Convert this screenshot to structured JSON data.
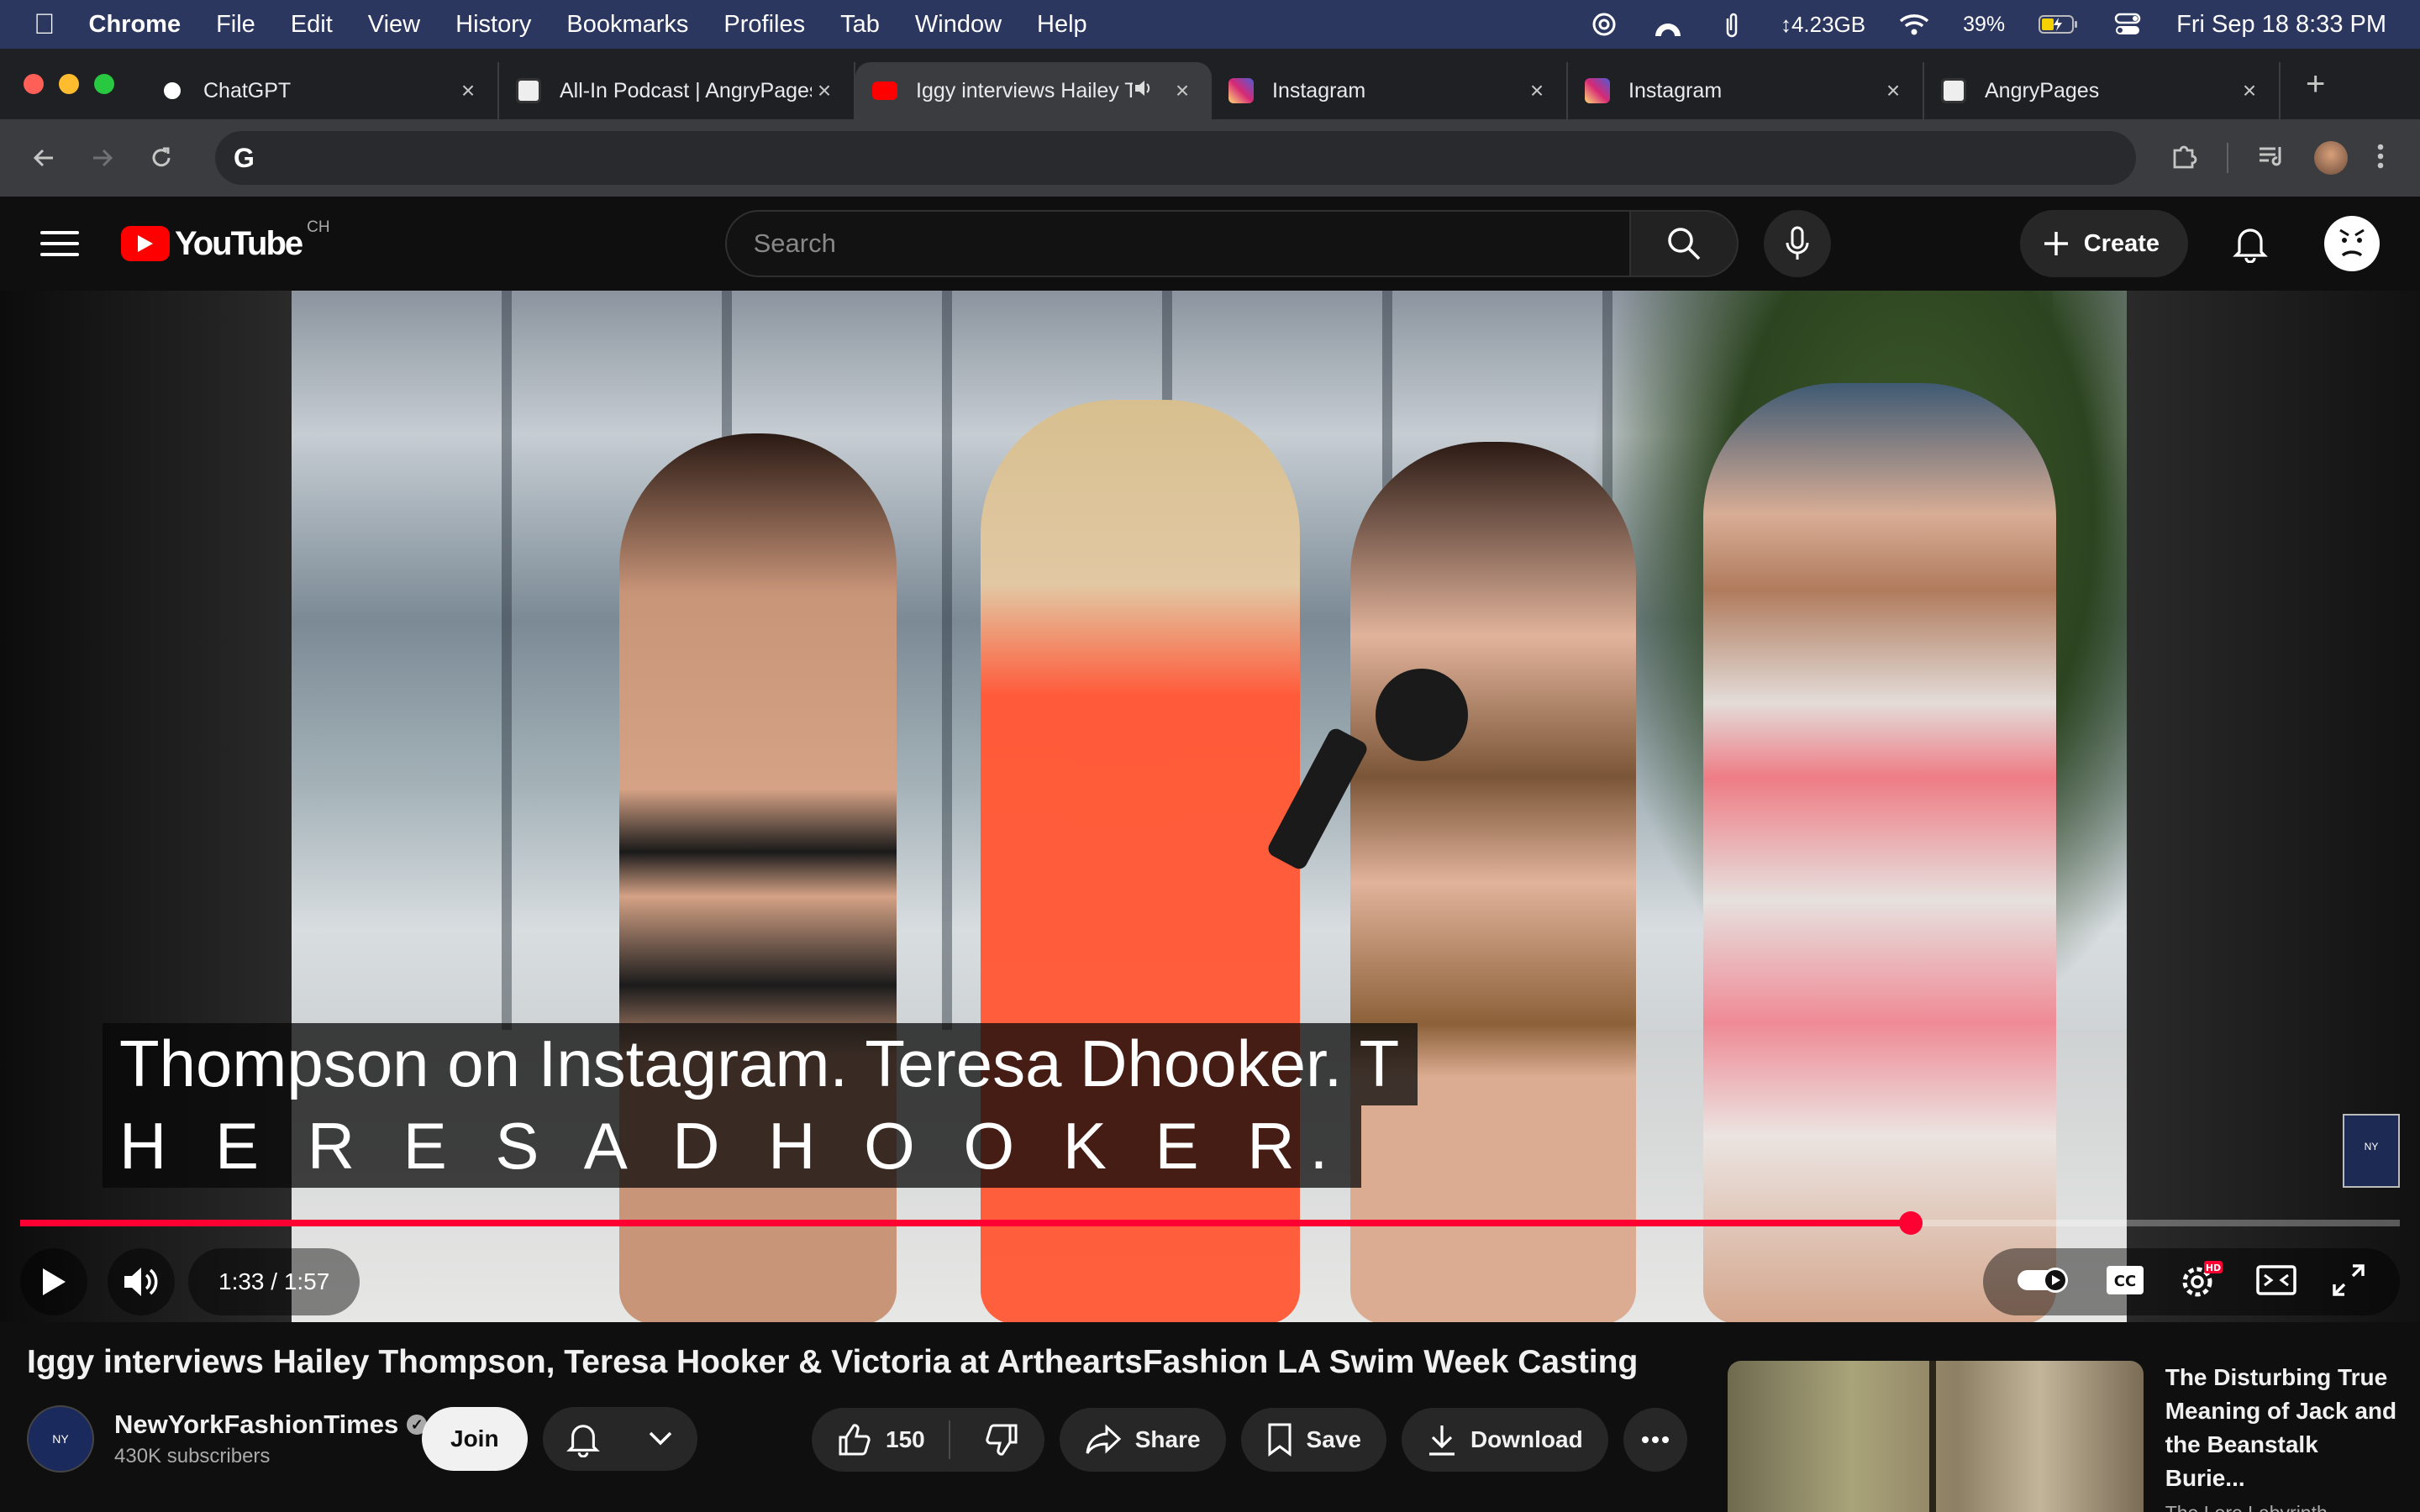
{
  "menubar": {
    "app_name": "Chrome",
    "items": [
      "File",
      "Edit",
      "View",
      "History",
      "Bookmarks",
      "Profiles",
      "Tab",
      "Window",
      "Help"
    ],
    "memory": "↕4.23GB",
    "battery": "39%",
    "datetime": "Fri Sep 18  8:33 PM"
  },
  "tabs": [
    {
      "title": "ChatGPT",
      "icon": "chatgpt-icon",
      "active": false
    },
    {
      "title": "All-In Podcast | AngryPages",
      "icon": "angrypages-icon",
      "active": false
    },
    {
      "title": "Iggy interviews Hailey Thompson",
      "icon": "youtube-icon",
      "active": true
    },
    {
      "title": "Instagram",
      "icon": "instagram-icon",
      "active": false
    },
    {
      "title": "Instagram",
      "icon": "instagram-icon",
      "active": false
    },
    {
      "title": "AngryPages",
      "icon": "angrypages-icon",
      "active": false
    }
  ],
  "toolbar": {
    "omnibox_value": "",
    "omnibox_icon": "G"
  },
  "youtube": {
    "logo_text": "YouTube",
    "country_code": "CH",
    "search_placeholder": "Search",
    "create_label": "Create"
  },
  "player": {
    "captions": [
      "Thompson on Instagram. Teresa Dhooker. T",
      "H E R E S A D H O O K E R."
    ],
    "current_time": "1:33",
    "duration": "1:57",
    "time_display": "1:33 / 1:57",
    "progress": 0.7945,
    "watermark_text": "NY"
  },
  "video": {
    "title": "Iggy interviews Hailey Thompson, Teresa Hooker & Victoria at ArtheartsFashion LA Swim Week Casting",
    "channel_name": "NewYorkFashionTimes",
    "subscribers": "430K subscribers",
    "join_label": "Join",
    "like_count": "150",
    "share_label": "Share",
    "save_label": "Save",
    "download_label": "Download"
  },
  "suggested": {
    "title": "The Disturbing True Meaning of Jack and the Beanstalk Burie...",
    "channel": "The Lore Labyrinth"
  },
  "colors": {
    "youtube_red": "#ff0000",
    "progress_red": "#ff0033",
    "menubar_bg": "#2c3760"
  }
}
